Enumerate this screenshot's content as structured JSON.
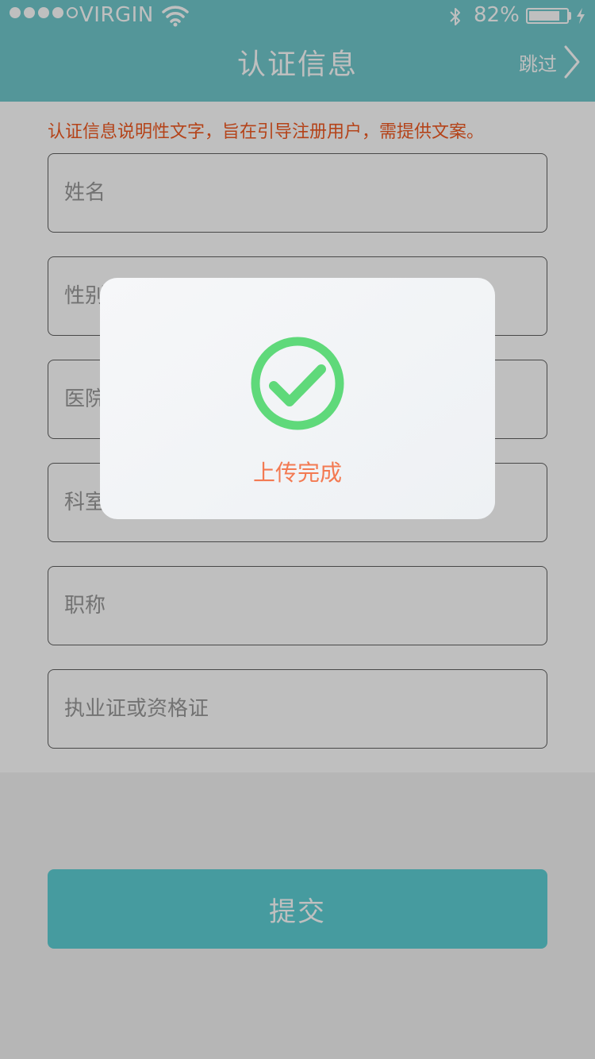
{
  "status_bar": {
    "carrier": "VIRGIN",
    "battery_percent": "82%",
    "battery_level": 0.82,
    "signal_bars_filled": 4,
    "signal_bars_total": 5,
    "icons": [
      "signal-dots-icon",
      "wifi-icon",
      "bluetooth-icon",
      "battery-icon",
      "charging-icon"
    ]
  },
  "nav": {
    "title": "认证信息",
    "skip_label": "跳过",
    "skip_icon": "chevron-right-icon"
  },
  "form": {
    "hint": "认证信息说明性文字，旨在引导注册用户，需提供文案。",
    "fields": [
      {
        "placeholder": "姓名"
      },
      {
        "placeholder": "性别"
      },
      {
        "placeholder": "医院"
      },
      {
        "placeholder": "科室"
      },
      {
        "placeholder": "职称"
      },
      {
        "placeholder": "执业证或资格证"
      }
    ],
    "submit_label": "提交"
  },
  "modal": {
    "icon": "check-circle-icon",
    "message": "上传完成"
  },
  "colors": {
    "header": "#71c9cc",
    "hint": "#f15a22",
    "submit": "#5ecfd4",
    "check": "#5fd97a",
    "modal_text": "#f37a52"
  }
}
